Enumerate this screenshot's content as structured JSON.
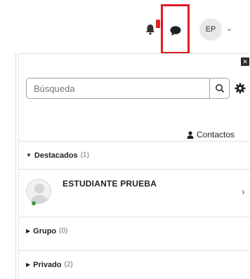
{
  "navbar": {
    "avatar_initials": "EP",
    "user_menu_caret": "⌄"
  },
  "drawer": {
    "close_glyph": "✕",
    "search": {
      "placeholder": "Búsqueda"
    },
    "contacts_label": "Contactos",
    "sections": [
      {
        "label": "Destacados",
        "count": "(1)",
        "expanded": true,
        "tri": "▼"
      },
      {
        "label": "Grupo",
        "count": "(0)",
        "expanded": false,
        "tri": "▶"
      },
      {
        "label": "Privado",
        "count": "(2)",
        "expanded": false,
        "tri": "▶"
      }
    ],
    "contact": {
      "name": "ESTUDIANTE PRUEBA",
      "online": true,
      "chevron": "›"
    }
  },
  "colors": {
    "highlight_border": "#e01b24",
    "online": "#3c9a3c",
    "notification_badge": "#e02424"
  },
  "icons": [
    "bell-icon",
    "chat-icon",
    "search-icon",
    "gear-icon",
    "user-icon",
    "close-icon",
    "chevron-right-icon"
  ]
}
